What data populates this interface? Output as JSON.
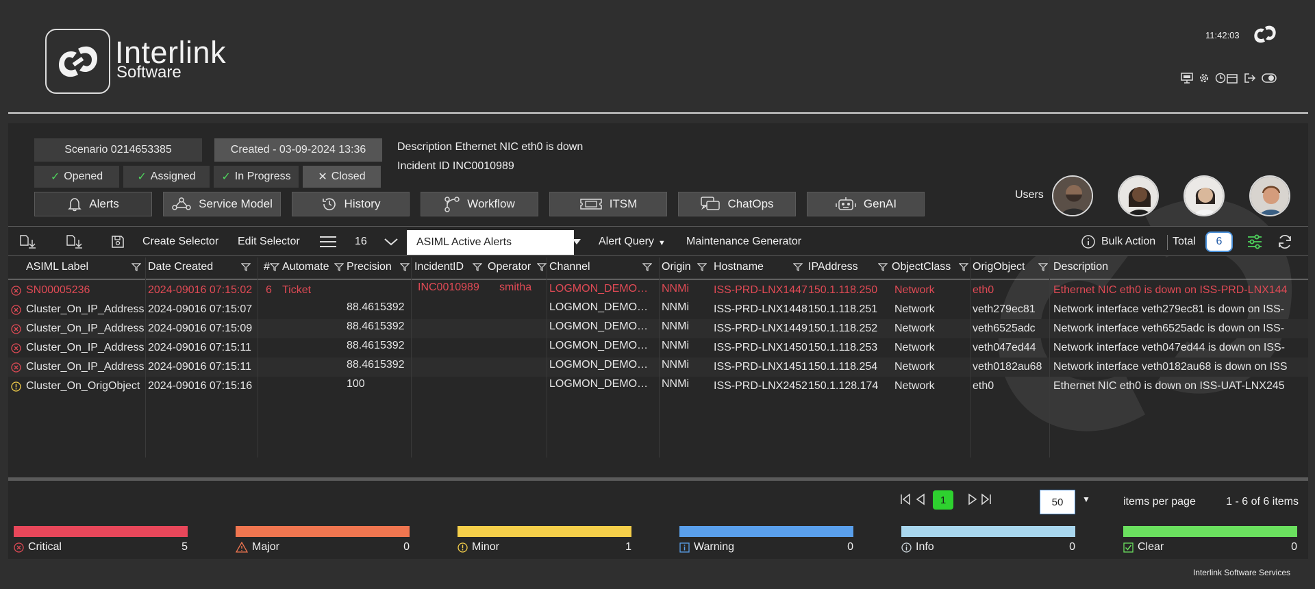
{
  "header": {
    "brand_name": "Interlink",
    "brand_sub": "Software",
    "clock": "11:42:03",
    "tools": [
      "monitor-icon",
      "gear-icon",
      "clock-calendar-icon",
      "logout-icon",
      "toggle-icon"
    ]
  },
  "scenario": {
    "scenario_label": "Scenario 0214653385",
    "created_label": "Created - 03-09-2024 13:36",
    "description": "Description Ethernet NIC eth0 is down",
    "incident": "Incident ID INC0010989",
    "statuses": [
      {
        "label": "Opened",
        "done": true
      },
      {
        "label": "Assigned",
        "done": true
      },
      {
        "label": "In Progress",
        "done": true
      },
      {
        "label": "Closed",
        "done": false
      }
    ]
  },
  "nav_buttons": [
    {
      "label": "Alerts",
      "icon": "bell-icon"
    },
    {
      "label": "Service Model",
      "icon": "network-icon"
    },
    {
      "label": "History",
      "icon": "history-icon"
    },
    {
      "label": "Workflow",
      "icon": "workflow-icon"
    },
    {
      "label": "ITSM",
      "icon": "ticket-icon"
    },
    {
      "label": "ChatOps",
      "icon": "chat-icon"
    },
    {
      "label": "GenAI",
      "icon": "robot-icon"
    }
  ],
  "users": {
    "label": "Users"
  },
  "toolbar": {
    "create_selector": "Create Selector",
    "edit_selector": "Edit Selector",
    "count": "16",
    "query_value": "ASIML Active Alerts",
    "alert_query": "Alert Query",
    "maintenance": "Maintenance Generator",
    "bulk_action": "Bulk Action",
    "total_label": "Total",
    "total_value": "6"
  },
  "table": {
    "columns": [
      "ASIML Label",
      "Date Created",
      "#",
      "Automate",
      "Precision",
      "IncidentID",
      "Operator",
      "Channel",
      "Origin",
      "Hostname",
      "IPAddress",
      "ObjectClass",
      "OrigObject",
      "Description"
    ],
    "rows": [
      {
        "severity": "critical",
        "highlight": true,
        "cells": [
          "SN00005236",
          "2024-09016 07:15:02",
          "6",
          "Ticket",
          "",
          "INC0010989",
          "smitha",
          "LOGMON_DEMO…",
          "NNMi",
          "ISS-PRD-LNX1447",
          "150.1.118.250",
          "Network",
          "eth0",
          "Ethernet NIC eth0 is down on ISS-PRD-LNX144"
        ]
      },
      {
        "severity": "critical",
        "highlight": false,
        "cells": [
          "Cluster_On_IP_Address",
          "2024-09016 07:15:07",
          "",
          "",
          "88.4615392",
          "",
          "",
          "LOGMON_DEMO…",
          "NNMi",
          "ISS-PRD-LNX1448",
          "150.1.118.251",
          "Network",
          "veth279ec81",
          "Network interface veth279ec81 is down on ISS-"
        ]
      },
      {
        "severity": "critical",
        "highlight": false,
        "cells": [
          "Cluster_On_IP_Address",
          "2024-09016 07:15:09",
          "",
          "",
          "88.4615392",
          "",
          "",
          "LOGMON_DEMO…",
          "NNMi",
          "ISS-PRD-LNX1449",
          "150.1.118.252",
          "Network",
          "veth6525adc",
          "Network interface veth6525adc is down on ISS-"
        ]
      },
      {
        "severity": "critical",
        "highlight": false,
        "cells": [
          "Cluster_On_IP_Address",
          "2024-09016 07:15:11",
          "",
          "",
          "88.4615392",
          "",
          "",
          "LOGMON_DEMO…",
          "NNMi",
          "ISS-PRD-LNX1450",
          "150.1.118.253",
          "Network",
          "veth047ed44",
          "Network interface veth047ed44 is down on ISS-"
        ]
      },
      {
        "severity": "critical",
        "highlight": false,
        "cells": [
          "Cluster_On_IP_Address",
          "2024-09016 07:15:11",
          "",
          "",
          "88.4615392",
          "",
          "",
          "LOGMON_DEMO…",
          "NNMi",
          "ISS-PRD-LNX1451",
          "150.1.118.254",
          "Network",
          "veth0182au68",
          "Network interface veth0182au68 is down on ISS"
        ]
      },
      {
        "severity": "minor",
        "highlight": false,
        "cells": [
          "Cluster_On_OrigObject",
          "2024-09016 07:15:16",
          "",
          "",
          "100",
          "",
          "",
          "LOGMON_DEMO…",
          "NNMi",
          "ISS-PRD-LNX2452",
          "150.1.128.174",
          "Network",
          "eth0",
          "Ethernet NIC eth0 is down on ISS-UAT-LNX245"
        ]
      }
    ]
  },
  "pager": {
    "current_page": "1",
    "per_page": "50",
    "per_page_label": "items per page",
    "range": "1 - 6 of 6 items"
  },
  "severities": [
    {
      "label": "Critical",
      "count": "5",
      "color": "#e8475a",
      "icon": "critical-icon"
    },
    {
      "label": "Major",
      "count": "0",
      "color": "#f07650",
      "icon": "warning-triangle-icon"
    },
    {
      "label": "Minor",
      "count": "1",
      "color": "#f5cf4a",
      "icon": "minor-icon"
    },
    {
      "label": "Warning",
      "count": "0",
      "color": "#5aa0ec",
      "icon": "info-square-icon"
    },
    {
      "label": "Info",
      "count": "0",
      "color": "#a9d7ee",
      "icon": "info-circle-icon"
    },
    {
      "label": "Clear",
      "count": "0",
      "color": "#6be05f",
      "icon": "checkbox-icon"
    }
  ],
  "footer": {
    "text": "Interlink Software Services"
  }
}
